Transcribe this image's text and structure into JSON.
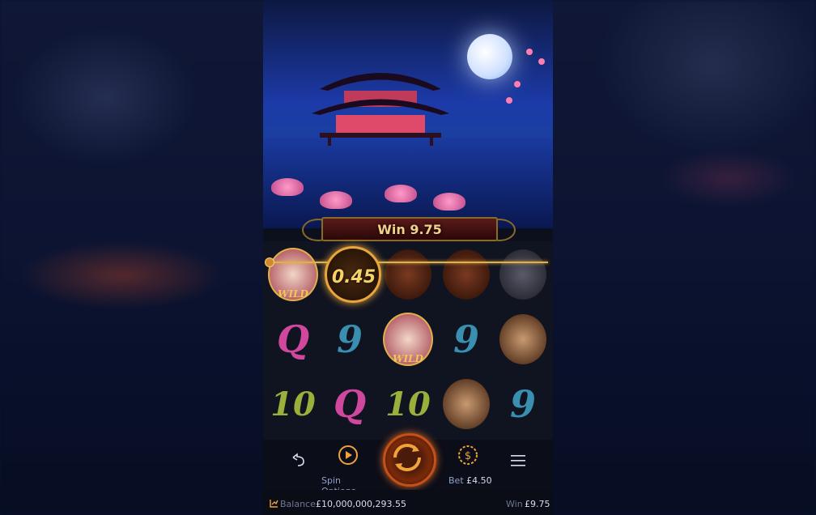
{
  "win_banner": {
    "label": "Win",
    "amount": "9.75"
  },
  "payline_win": "0.45",
  "reels": [
    [
      {
        "symbol": "wild",
        "label": "WILD"
      },
      {
        "symbol": "warrior-gold",
        "label": ""
      },
      {
        "symbol": "warrior-red",
        "label": ""
      },
      {
        "symbol": "warrior-red",
        "label": ""
      },
      {
        "symbol": "warrior-armored",
        "label": ""
      }
    ],
    [
      {
        "symbol": "Q",
        "label": "Q"
      },
      {
        "symbol": "9",
        "label": "9"
      },
      {
        "symbol": "wild",
        "label": "WILD"
      },
      {
        "symbol": "9",
        "label": "9"
      },
      {
        "symbol": "general",
        "label": ""
      }
    ],
    [
      {
        "symbol": "10",
        "label": "10"
      },
      {
        "symbol": "Q",
        "label": "Q"
      },
      {
        "symbol": "10",
        "label": "10"
      },
      {
        "symbol": "general",
        "label": ""
      },
      {
        "symbol": "9",
        "label": "9"
      }
    ]
  ],
  "symbol_colors": {
    "Q": "#d0479e",
    "9": "#3a8fb0",
    "10": "#9bb03a"
  },
  "controls": {
    "back_icon": "undo-icon",
    "spin_options_label": "Spin Options",
    "bet_label": "Bet",
    "bet_value": "£4.50",
    "menu_icon": "menu-icon"
  },
  "footer": {
    "balance_label": "Balance",
    "balance_value": "£10,000,000,293.55",
    "win_label": "Win",
    "win_value": "£9.75"
  }
}
